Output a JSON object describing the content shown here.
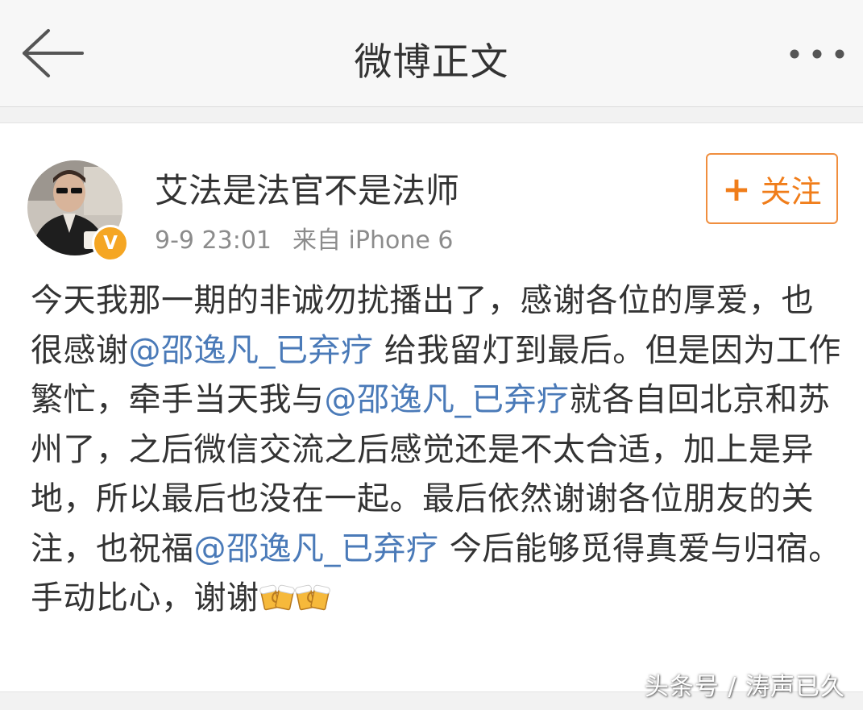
{
  "nav": {
    "title": "微博正文",
    "back_icon": "arrow-left-icon",
    "more_icon": "more-dots-icon"
  },
  "post": {
    "author": "艾法是法官不是法师",
    "verified_badge": "V",
    "time": "9-9 23:01",
    "source": "来自 iPhone 6",
    "follow_label": "关注",
    "segments": [
      {
        "type": "text",
        "text": "今天我那一期的非诚勿扰播出了，感谢各位的厚爱，也很感谢"
      },
      {
        "type": "mention",
        "text": "@邵逸凡_已弃疗"
      },
      {
        "type": "text",
        "text": " 给我留灯到最后。但是因为工作繁忙，牵手当天我与"
      },
      {
        "type": "mention",
        "text": "@邵逸凡_已弃疗"
      },
      {
        "type": "text",
        "text": "就各自回北京和苏州了，之后微信交流之后感觉还是不太合适，加上是异地，所以最后也没在一起。最后依然谢谢各位朋友的关注，也祝福"
      },
      {
        "type": "mention",
        "text": "@邵逸凡_已弃疗"
      },
      {
        "type": "text",
        "text": " 今后能够觅得真爱与归宿。手动比心，谢谢"
      }
    ],
    "emoji": [
      "beer-cheers-icon",
      "beer-cheers-icon"
    ]
  },
  "watermark": "头条号 / 涛声已久",
  "colors": {
    "accent_orange": "#f07d1a",
    "mention_blue": "#4a7ab8",
    "verified_gold": "#f5a623"
  }
}
